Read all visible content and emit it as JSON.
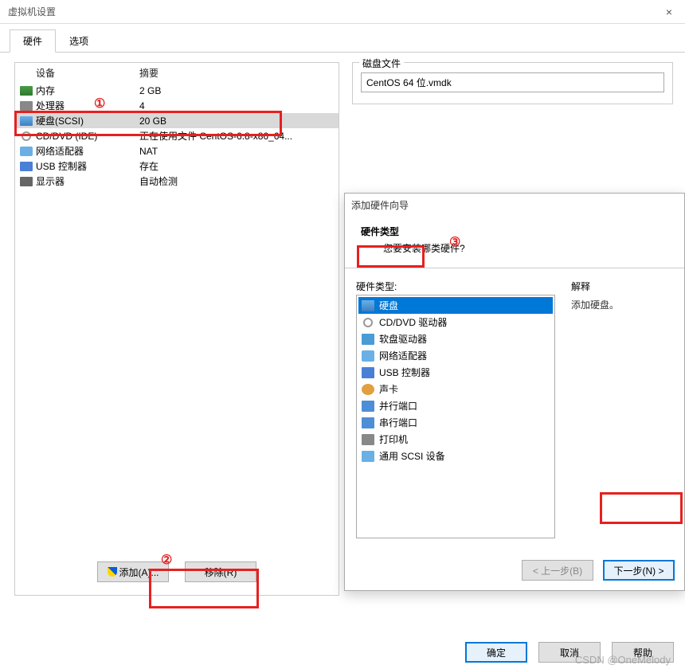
{
  "window": {
    "title": "虚拟机设置"
  },
  "tabs": [
    {
      "label": "硬件",
      "active": true
    },
    {
      "label": "选项",
      "active": false
    }
  ],
  "device_headers": {
    "col1": "设备",
    "col2": "摘要"
  },
  "devices": [
    {
      "icon": "memory-icon",
      "name": "内存",
      "summary": "2 GB"
    },
    {
      "icon": "cpu-icon",
      "name": "处理器",
      "summary": "4"
    },
    {
      "icon": "hdd-icon",
      "name": "硬盘(SCSI)",
      "summary": "20 GB",
      "selected": true
    },
    {
      "icon": "cd-icon",
      "name": "CD/DVD (IDE)",
      "summary": "正在使用文件 CentOS-6.8-x86_64..."
    },
    {
      "icon": "net-icon",
      "name": "网络适配器",
      "summary": "NAT"
    },
    {
      "icon": "usb-icon",
      "name": "USB 控制器",
      "summary": "存在"
    },
    {
      "icon": "display-icon",
      "name": "显示器",
      "summary": "自动检测"
    }
  ],
  "panel_buttons": {
    "add": "添加(A)...",
    "remove": "移除(R)"
  },
  "disk_section": {
    "legend": "磁盘文件",
    "value": "CentOS 64 位.vmdk"
  },
  "wizard": {
    "title": "添加硬件向导",
    "h1": "硬件类型",
    "h2": "您要安装哪类硬件?",
    "list_label": "硬件类型:",
    "explain_label": "解释",
    "explain_text": "添加硬盘。",
    "items": [
      {
        "icon": "hdd-icon",
        "label": "硬盘",
        "selected": true
      },
      {
        "icon": "cd-icon",
        "label": "CD/DVD 驱动器"
      },
      {
        "icon": "floppy-icon",
        "label": "软盘驱动器"
      },
      {
        "icon": "net-icon",
        "label": "网络适配器"
      },
      {
        "icon": "usb-icon",
        "label": "USB 控制器"
      },
      {
        "icon": "sound-icon",
        "label": "声卡"
      },
      {
        "icon": "parallel-icon",
        "label": "并行端口"
      },
      {
        "icon": "serial-icon",
        "label": "串行端口"
      },
      {
        "icon": "printer-icon",
        "label": "打印机"
      },
      {
        "icon": "scsi-icon",
        "label": "通用 SCSI 设备"
      }
    ],
    "back": "< 上一步(B)",
    "next": "下一步(N) >"
  },
  "footer": {
    "ok": "确定",
    "cancel": "取消",
    "help": "帮助"
  },
  "annotations": {
    "n1": "①",
    "n2": "②",
    "n3": "③"
  },
  "watermark": "CSDN @OneMelody"
}
